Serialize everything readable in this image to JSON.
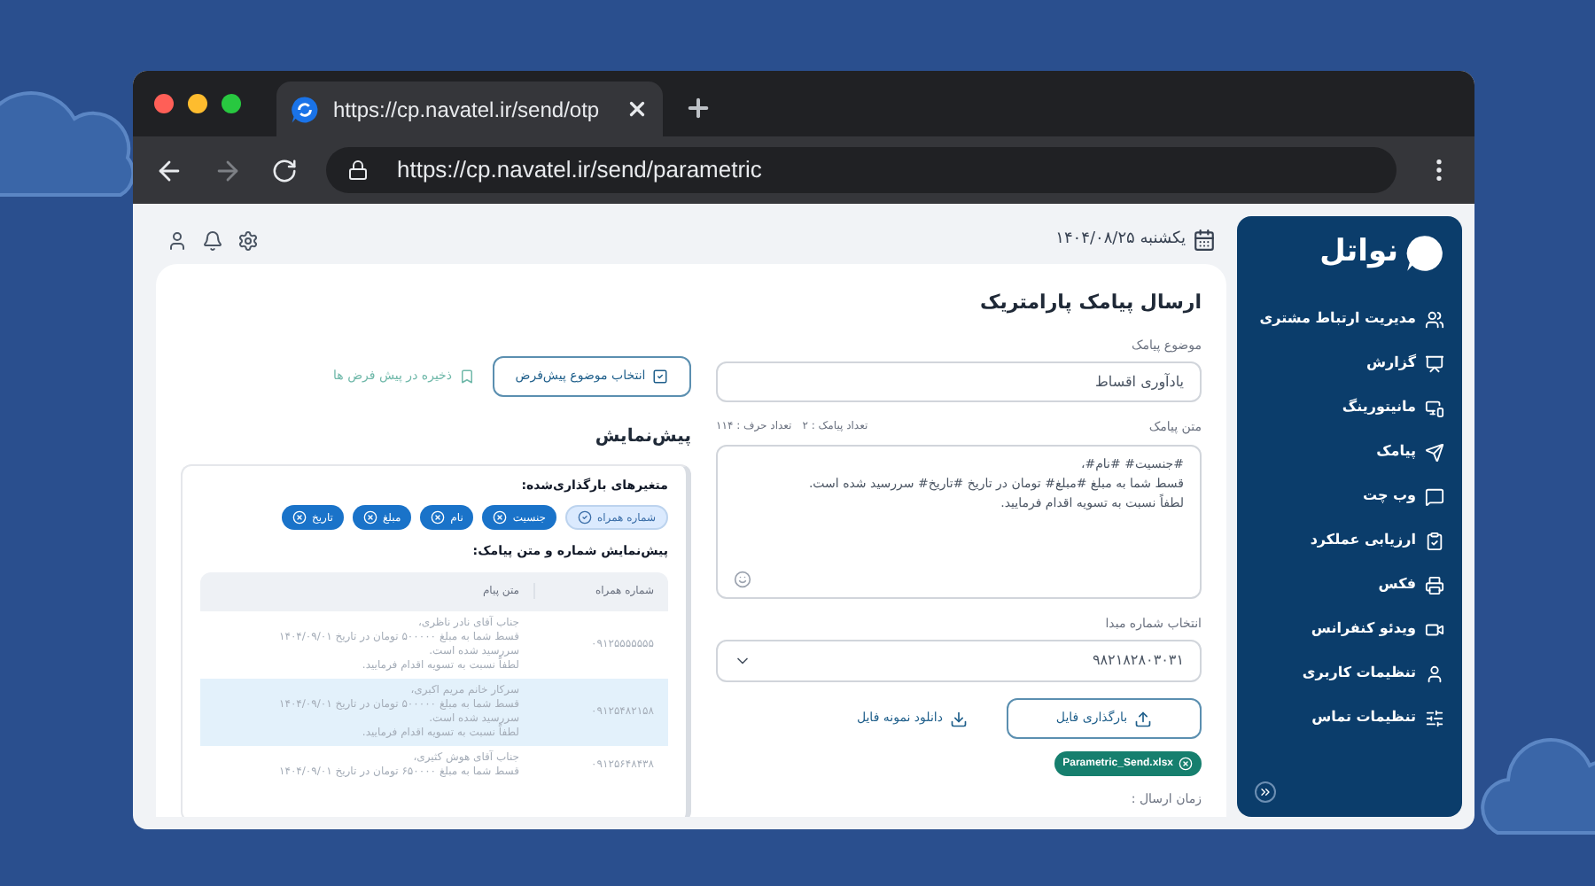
{
  "browser": {
    "tab_title": "https://cp.navatel.ir/send/otp",
    "address": "https://cp.navatel.ir/send/parametric"
  },
  "sidebar": {
    "logo_text": "نواتل",
    "items": [
      {
        "label": "مدیریت ارتباط مشتری",
        "kind": "users"
      },
      {
        "label": "گزارش",
        "kind": "report"
      },
      {
        "label": "مانیتورینگ",
        "kind": "monitor"
      },
      {
        "label": "پیامک",
        "kind": "send"
      },
      {
        "label": "وب چت",
        "kind": "chat"
      },
      {
        "label": "ارزیابی عملکرد",
        "kind": "clipboard"
      },
      {
        "label": "فکس",
        "kind": "printer"
      },
      {
        "label": "ویدئو کنفرانس",
        "kind": "video"
      },
      {
        "label": "تنظیمات کاربری",
        "kind": "user"
      },
      {
        "label": "تنظیمات تماس",
        "kind": "sliders"
      }
    ]
  },
  "top_bar": {
    "date": "یکشنبه ۱۴۰۴/۰۸/۲۵"
  },
  "form": {
    "title": "ارسال پیامک پارامتریک",
    "subject_label": "موضوع پیامک",
    "subject_value": "یادآوری اقساط",
    "choose_default_button": "انتخاب موضوع پیش‌فرض",
    "save_default_link": "ذخیره در پیش فرض ها",
    "message_label": "متن پیامک",
    "sms_count": "تعداد پیامک : ۲",
    "char_count": "تعداد حرف : ۱۱۴",
    "message_lines": [
      "#جنسیت# #نام#،",
      "قسط شما به مبلغ #مبلغ# تومان در تاریخ #تاریخ# سررسید شده است.",
      "لطفاً نسبت به تسویه اقدام فرمایید."
    ],
    "sender_label": "انتخاب شماره مبدا",
    "sender_value": "۹۸۲۱۸۲۸۰۳۰۳۱",
    "upload_button": "بارگذاری فایل",
    "download_link": "دانلود نمونه فایل",
    "file_chip": "Parametric_Send.xlsx",
    "send_time_label": "زمان ارسال :"
  },
  "preview": {
    "title": "پیش‌نمایش",
    "variables_title": "متغیرهای بارگذاری‌شده:",
    "variables": [
      {
        "label": "شماره همراه",
        "kind": "fixed"
      },
      {
        "label": "جنسیت",
        "kind": "removable"
      },
      {
        "label": "نام",
        "kind": "removable"
      },
      {
        "label": "مبلغ",
        "kind": "removable"
      },
      {
        "label": "تاریخ",
        "kind": "removable"
      }
    ],
    "table_title": "پیش‌نمایش شماره و متن پیامک:",
    "columns": [
      "شماره همراه",
      "متن پیام"
    ],
    "rows": [
      {
        "phone": "۰۹۱۲۵۵۵۵۵۵۵",
        "lines": [
          "جناب آقای نادر ناظری،",
          "قسط شما به مبلغ ۵۰۰۰۰۰ تومان در تاریخ ۱۴۰۴/۰۹/۰۱",
          "سررسید شده است.",
          "لطفاً نسبت به تسویه اقدام فرمایید."
        ],
        "selected": false
      },
      {
        "phone": "۰۹۱۲۵۴۸۲۱۵۸",
        "lines": [
          "سرکار خانم مریم اکبری،",
          "قسط شما به مبلغ ۵۰۰۰۰۰ تومان در تاریخ ۱۴۰۴/۰۹/۰۱",
          "سررسید شده است.",
          "لطفاً نسبت به تسویه اقدام فرمایید."
        ],
        "selected": true
      },
      {
        "phone": "۰۹۱۲۵۶۴۸۴۳۸",
        "lines": [
          "جناب آقای هوش کثیری،",
          "قسط شما به مبلغ ۶۵۰۰۰۰ تومان در تاریخ ۱۴۰۴/۰۹/۰۱"
        ],
        "selected": false
      }
    ]
  }
}
